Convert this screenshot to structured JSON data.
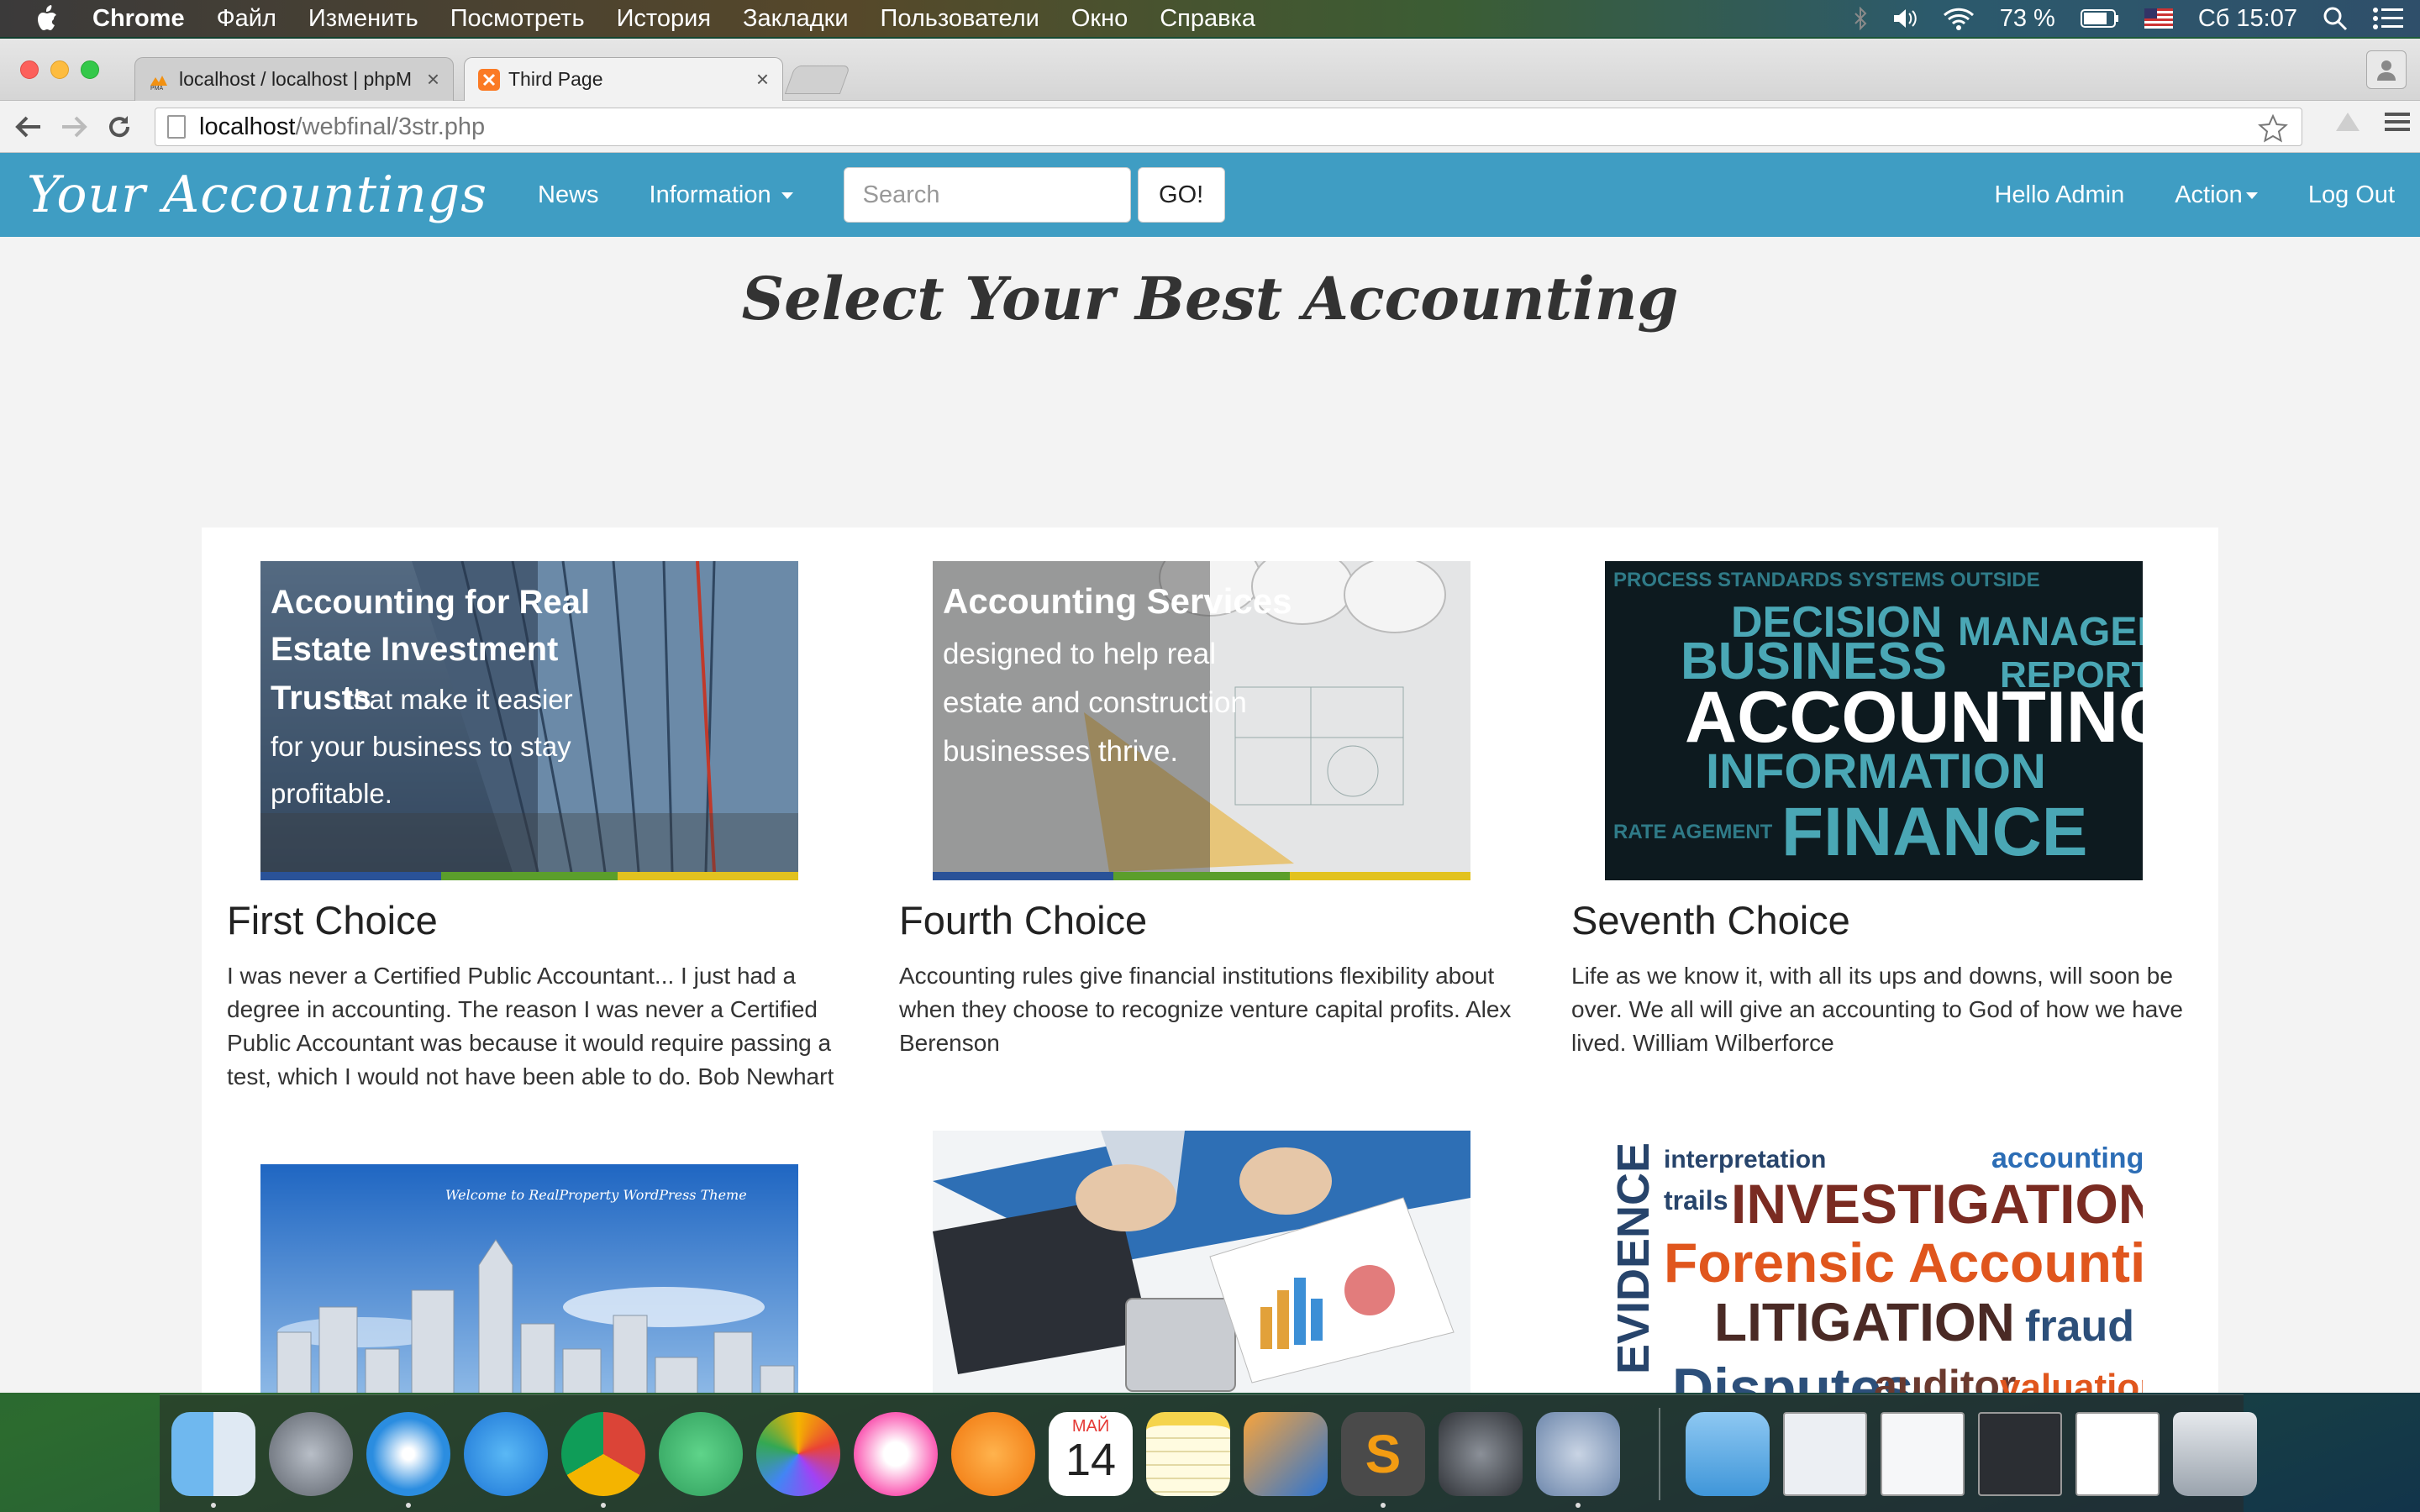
{
  "menubar": {
    "items": [
      "Chrome",
      "Файл",
      "Изменить",
      "Посмотреть",
      "История",
      "Закладки",
      "Пользователи",
      "Окно",
      "Справка"
    ],
    "battery": "73 %",
    "clock": "Сб 15:07"
  },
  "browser": {
    "tabs": [
      {
        "title": "localhost / localhost | phpM"
      },
      {
        "title": "Third Page"
      }
    ],
    "url_host": "localhost",
    "url_path": "/webfinal/3str.php"
  },
  "site": {
    "brand": "Your Accountings",
    "nav": {
      "news": "News",
      "information": "Information"
    },
    "search": {
      "placeholder": "Search",
      "button": "GO!"
    },
    "right": {
      "greeting": "Hello Admin",
      "action": "Action",
      "logout": "Log Out"
    },
    "heading": "Select Your Best Accounting",
    "cards": [
      {
        "title": "First Choice",
        "text": "I was never a Certified Public Accountant... I just had a degree in accounting. The reason I was never a Certified Public Accountant was because it would require passing a test, which I would not have been able to do. Bob Newhart",
        "image_text": {
          "line1": "Accounting for Real",
          "line2": "Estate Investment",
          "line3": "Trusts",
          "line3b": "that make it easier",
          "line4": "for your business to stay",
          "line5": "profitable."
        }
      },
      {
        "title": "Fourth Choice",
        "text": "Accounting rules give financial institutions flexibility about when they choose to recognize venture capital profits. Alex Berenson",
        "image_text": {
          "line1": "Accounting Services",
          "line2": "designed to help real",
          "line3": "estate and construction",
          "line4": "businesses thrive."
        }
      },
      {
        "title": "Seventh Choice",
        "text": "Life as we know it, with all its ups and downs, will soon be over. We all will give an accounting to God of how we have lived. William Wilberforce",
        "image_text": {
          "w1": "ACCOUNTING",
          "w2": "INFORMATION",
          "w3": "FINANCE",
          "w4": "BUSINESS",
          "w5": "DECISION",
          "w6": "MANAGER",
          "w7": "REPORT"
        }
      }
    ],
    "row2": {
      "city_caption": "Welcome to RealProperty WordPress Theme",
      "words": {
        "a": "interpretation",
        "b": "accounting",
        "c": "INVESTIGATION",
        "d": "Forensic Accounting",
        "e": "LITIGATION",
        "f": "fraud",
        "g": "Disputes",
        "h": "auditor",
        "i": "valuation",
        "j": "EVIDENCE",
        "k": "trails"
      }
    }
  },
  "dock": {
    "calendar_month": "МАЙ",
    "calendar_day": "14"
  },
  "colors": {
    "navbar": "#3f9dc3",
    "page_bg": "#f3f3f3"
  }
}
